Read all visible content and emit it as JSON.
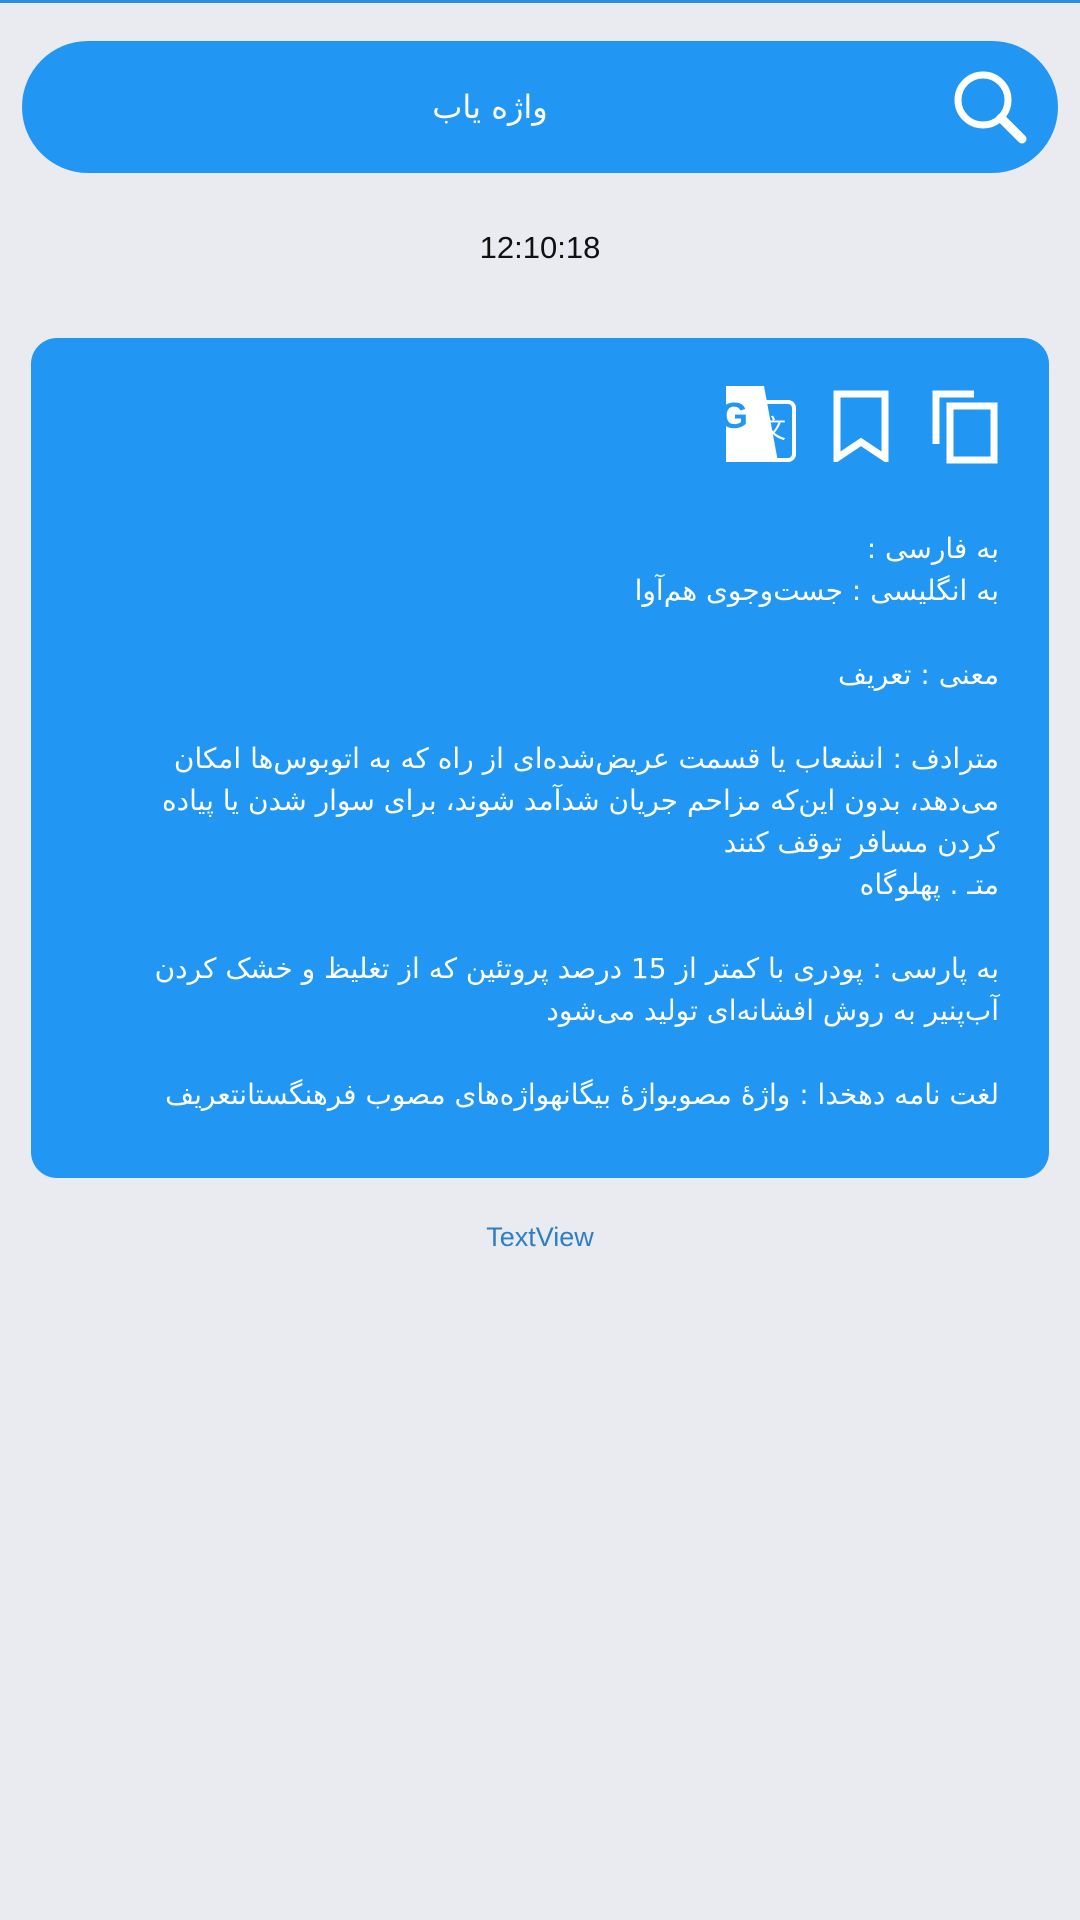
{
  "search": {
    "placeholder": "واژه یاب",
    "icon": "search-icon"
  },
  "clock": {
    "time": "12:10:18"
  },
  "card": {
    "icons": [
      "translate-icon",
      "bookmark-icon",
      "copy-icon"
    ],
    "farsi_line": "به فارسی :",
    "english_line": "به انگلیسی : جست‌وجوی هم‌آوا",
    "meaning_line": "معنی : تعریف",
    "synonym_line1": "مترادف : انشعاب یا قسمت عریض‌شده‌ای از راه که به اتوبوس‌ها امکان",
    "synonym_line2": "می‌دهد، بدون این‌که مزاحم جریان شدآمد شوند، برای سوار شدن یا پیاده",
    "synonym_line3": "کردن مسافر توقف کنند",
    "synonym_line4": "متـ . پهلوگاه",
    "parsi_line1": "به پارسی : پودری با کمتر از 15 درصد پروتئین که از تغلیظ و خشک کردن",
    "parsi_line2": "آب‌پنیر به روش افشانه‌ای تولید می‌شود",
    "dehkhoda_line": "لغت نامه دهخدا : واژهٔ مصوبواژهٔ بیگانهواژه‌های مصوب فرهنگستانتعریف"
  },
  "footer": {
    "label": "TextView"
  },
  "colors": {
    "accent": "#2196f3",
    "background": "#e9ebf1",
    "footer_text": "#2c7fc4"
  }
}
